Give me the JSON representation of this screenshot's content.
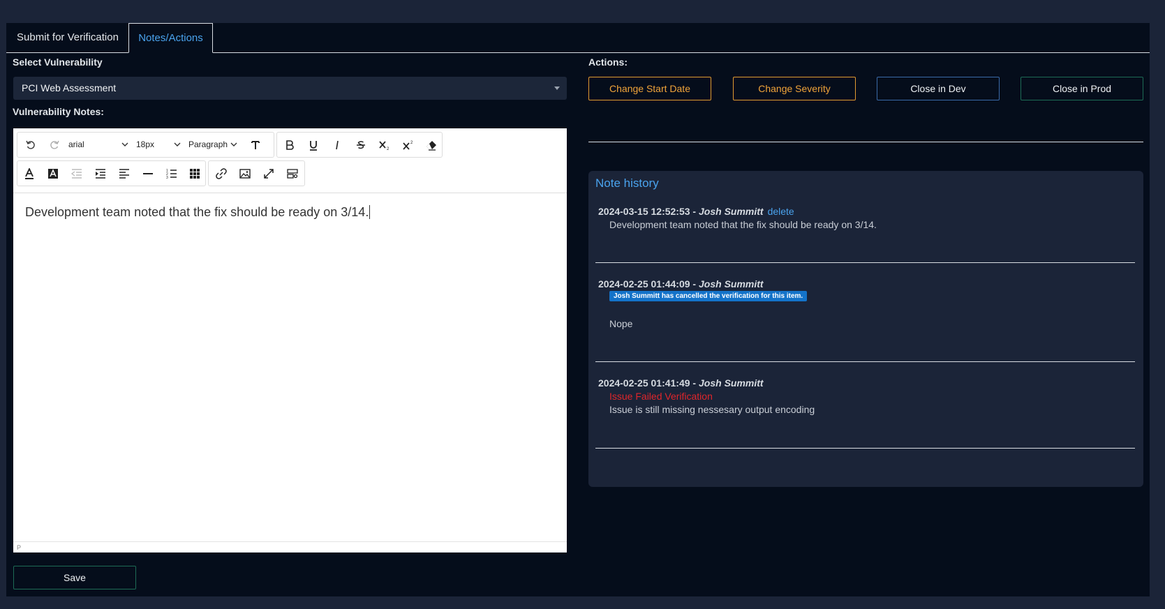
{
  "tabs": [
    {
      "label": "Submit for Verification"
    },
    {
      "label": "Notes/Actions",
      "active": true
    }
  ],
  "left": {
    "select_label": "Select Vulnerability",
    "select_value": "PCI Web Assessment",
    "notes_label": "Vulnerability Notes:",
    "save_label": "Save"
  },
  "editor": {
    "font": "arial",
    "font_size": "18px",
    "block_format": "Paragraph",
    "content": "Development team noted that the fix should be ready on 3/14.",
    "status_path": "P",
    "icons": [
      "undo-icon",
      "redo-icon",
      "line-height-icon",
      "bold-icon",
      "underline-icon",
      "italic-icon",
      "strikethrough-icon",
      "subscript-icon",
      "superscript-icon",
      "eraser-icon",
      "font-color-icon",
      "highlight-icon",
      "outdent-icon",
      "indent-icon",
      "align-left-icon",
      "horizontal-rule-icon",
      "ordered-list-icon",
      "table-icon",
      "link-icon",
      "image-icon",
      "fullscreen-icon",
      "template-icon"
    ]
  },
  "actions": {
    "label": "Actions:",
    "buttons": [
      {
        "label": "Change Start Date",
        "color": "#f0a43a"
      },
      {
        "label": "Change Severity",
        "color": "#f0a43a"
      },
      {
        "label": "Close in Dev",
        "color": "#3a6aa8"
      },
      {
        "label": "Close in Prod",
        "color": "#1d6b55"
      }
    ]
  },
  "history": {
    "title": "Note history",
    "entries": [
      {
        "timestamp": "2024-03-15 12:52:53",
        "sep": " - ",
        "author": "Josh Summitt",
        "delete_label": "delete",
        "note": "Development team noted that the fix should be ready on 3/14."
      },
      {
        "timestamp": "2024-02-25 01:44:09",
        "sep": " - ",
        "author": "Josh Summitt",
        "badge": "Josh Summitt has cancelled the verification for this item.",
        "note": "Nope"
      },
      {
        "timestamp": "2024-02-25 01:41:49",
        "sep": " - ",
        "author": "Josh Summitt",
        "status": "Issue Failed Verification",
        "note": "Issue is still missing nessesary output encoding"
      }
    ]
  }
}
